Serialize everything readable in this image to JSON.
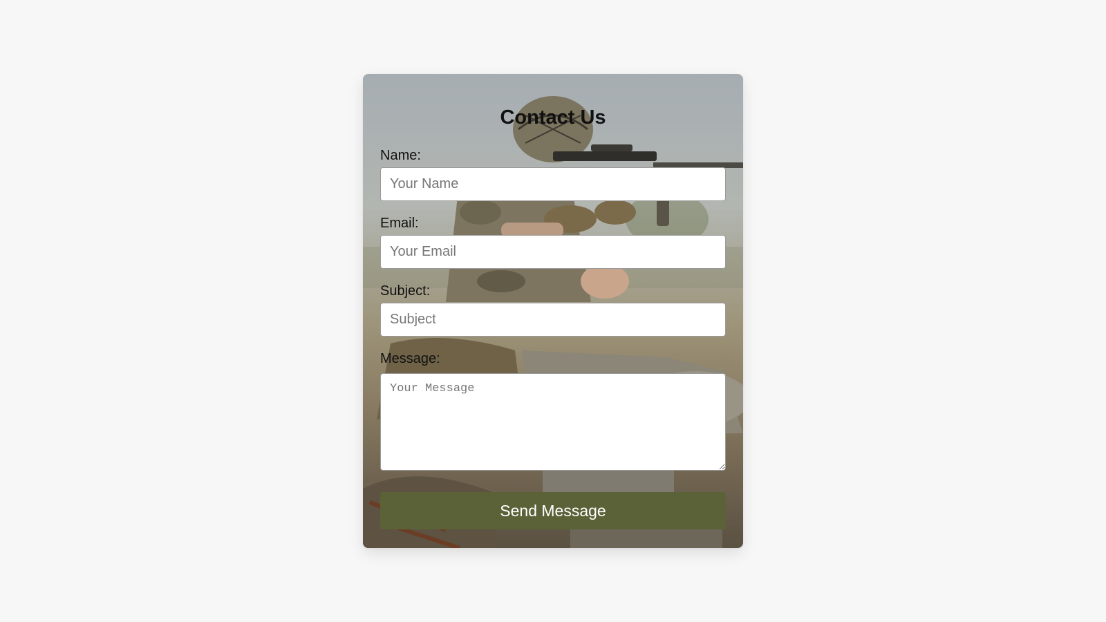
{
  "form": {
    "title": "Contact Us",
    "name_label": "Name:",
    "name_placeholder": "Your Name",
    "email_label": "Email:",
    "email_placeholder": "Your Email",
    "subject_label": "Subject:",
    "subject_placeholder": "Subject",
    "message_label": "Message:",
    "message_placeholder": "Your Message",
    "submit_label": "Send Message"
  },
  "colors": {
    "page_background": "#f7f7f7",
    "button": "#5b6238",
    "button_text": "#ffffff"
  }
}
